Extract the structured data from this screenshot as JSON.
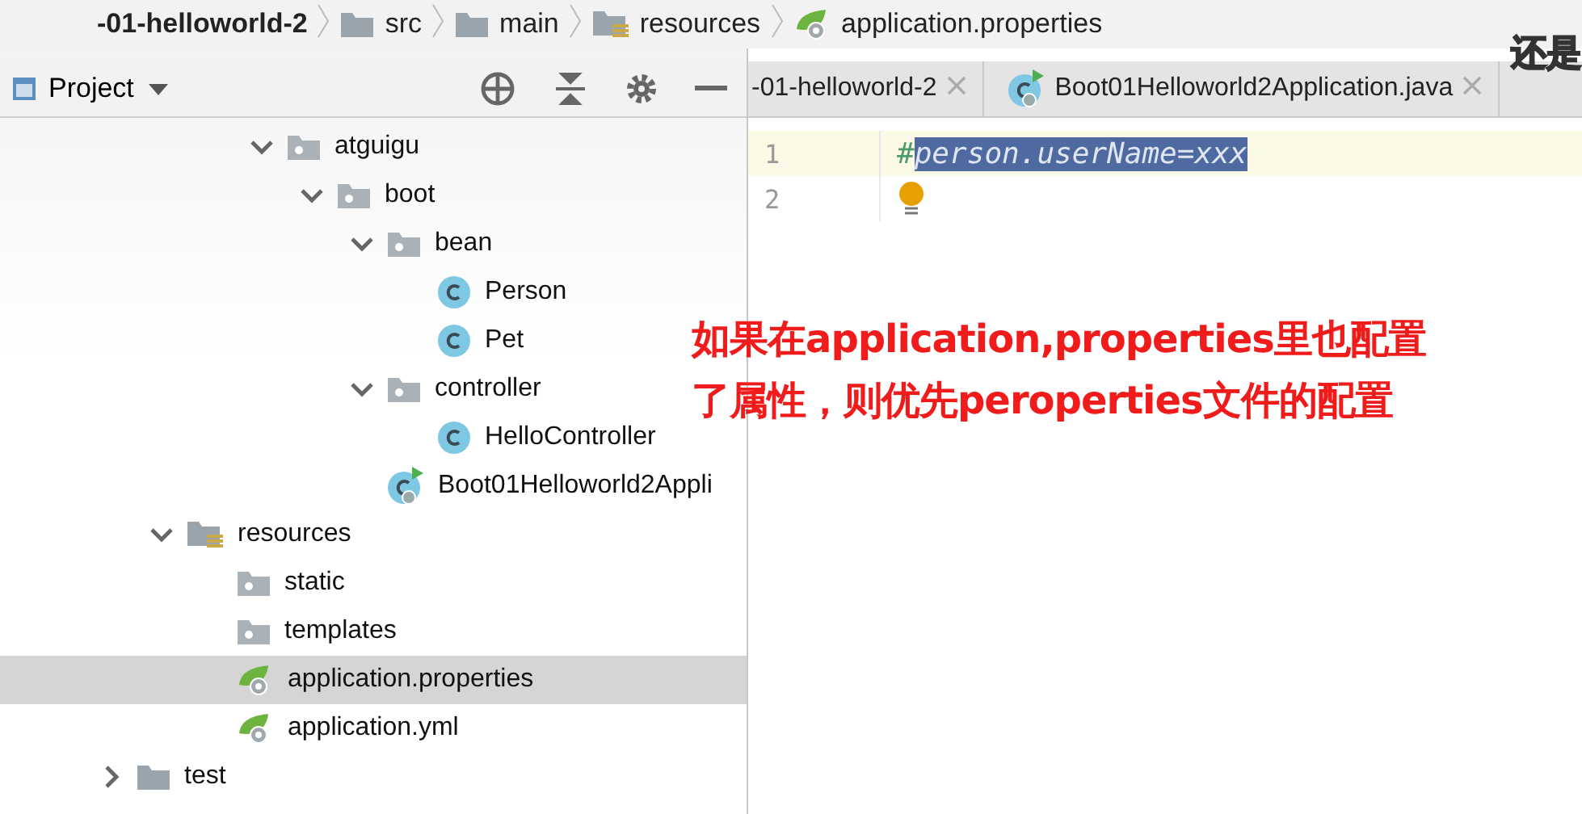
{
  "breadcrumbs": [
    {
      "label": "-01-helloworld-2",
      "kind": "module"
    },
    {
      "label": "src",
      "kind": "folder"
    },
    {
      "label": "main",
      "kind": "folder"
    },
    {
      "label": "resources",
      "kind": "resources"
    },
    {
      "label": "application.properties",
      "kind": "properties"
    }
  ],
  "project_panel": {
    "title": "Project"
  },
  "tree": [
    {
      "label": "atguigu",
      "kind": "package",
      "expanded": true,
      "selected": false,
      "children": [
        {
          "label": "boot",
          "kind": "package",
          "expanded": true,
          "selected": false,
          "children": [
            {
              "label": "bean",
              "kind": "package",
              "expanded": true,
              "selected": false,
              "children": [
                {
                  "label": "Person",
                  "kind": "class",
                  "selected": false
                },
                {
                  "label": "Pet",
                  "kind": "class",
                  "selected": false
                }
              ]
            },
            {
              "label": "controller",
              "kind": "package",
              "expanded": true,
              "selected": false,
              "children": [
                {
                  "label": "HelloController",
                  "kind": "class",
                  "selected": false
                }
              ]
            },
            {
              "label": "Boot01Helloworld2Appli",
              "kind": "app",
              "selected": false
            }
          ]
        }
      ]
    },
    {
      "label": "resources",
      "kind": "resources",
      "expanded": true,
      "selected": false,
      "children": [
        {
          "label": "static",
          "kind": "package",
          "selected": false
        },
        {
          "label": "templates",
          "kind": "package",
          "selected": false
        },
        {
          "label": "application.properties",
          "kind": "properties",
          "selected": true
        },
        {
          "label": "application.yml",
          "kind": "properties",
          "selected": false
        }
      ]
    },
    {
      "label": "test",
      "kind": "folder",
      "expanded": false,
      "selected": false
    }
  ],
  "editor_tabs": [
    {
      "label": "-01-helloworld-2",
      "kind": "plain",
      "selected": false
    },
    {
      "label": "Boot01Helloworld2Application.java",
      "kind": "app",
      "selected": false
    }
  ],
  "editor_lines": [
    {
      "number": "1",
      "current": true,
      "prefix": "#",
      "selected_text": "person.userName=xxx"
    },
    {
      "number": "2",
      "current": false,
      "bulb": true
    }
  ],
  "annotation": [
    "如果在application,properties里也配置",
    "了属性，则优先peroperties文件的配置"
  ],
  "subtitle": "还是"
}
